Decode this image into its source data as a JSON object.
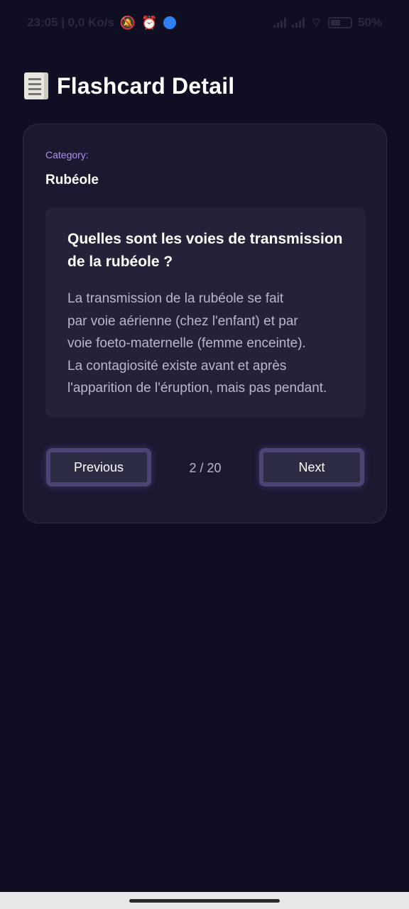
{
  "status_bar": {
    "time_speed": "23:05 | 0,0 Ko/s",
    "battery": "50%"
  },
  "header": {
    "title": "Flashcard Detail"
  },
  "card": {
    "category_label": "Category:",
    "category_value": "Rubéole",
    "question": "Quelles sont les voies de transmission de la rubéole ?",
    "answer": "La transmission de la rubéole se fait\npar voie aérienne (chez l'enfant) et par\nvoie foeto-maternelle (femme enceinte).\nLa contagiosité existe avant et après\nl'apparition de l'éruption, mais pas pendant."
  },
  "navigation": {
    "previous_label": "Previous",
    "next_label": "Next",
    "counter": "2 / 20"
  }
}
